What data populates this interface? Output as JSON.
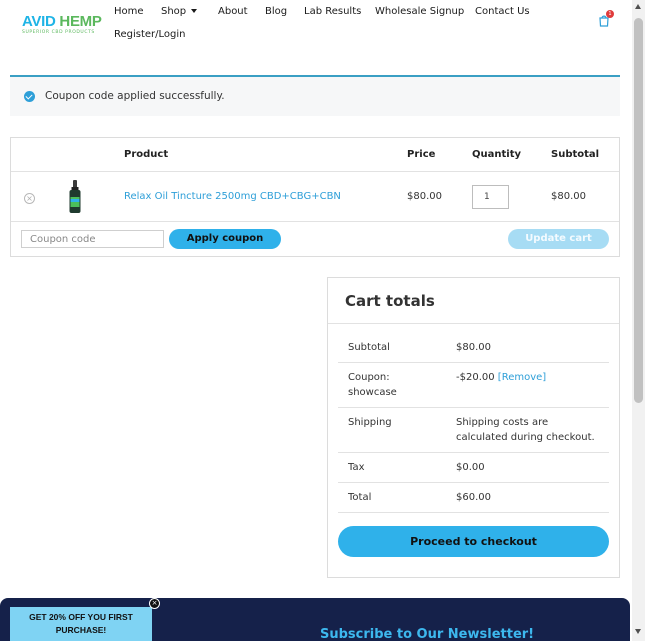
{
  "header": {
    "logo": {
      "main_a": "AVID",
      "main_b": "HEMP",
      "tagline": "SUPERIOR CBD PRODUCTS"
    },
    "nav": [
      {
        "label": "Home"
      },
      {
        "label": "Shop"
      },
      {
        "label": "About"
      },
      {
        "label": "Blog"
      },
      {
        "label": "Lab Results"
      },
      {
        "label": "Wholesale Signup"
      },
      {
        "label": "Contact Us"
      },
      {
        "label": "Register/Login"
      }
    ],
    "cart_count": "1"
  },
  "notice": {
    "text": "Coupon code applied successfully."
  },
  "cart_table": {
    "headers": {
      "product": "Product",
      "price": "Price",
      "quantity": "Quantity",
      "subtotal": "Subtotal"
    },
    "items": [
      {
        "name": "Relax Oil Tincture 2500mg CBD+CBG+CBN",
        "price": "$80.00",
        "quantity": "1",
        "subtotal": "$80.00"
      }
    ],
    "coupon_placeholder": "Coupon code",
    "apply_coupon_label": "Apply coupon",
    "update_cart_label": "Update cart"
  },
  "cart_totals": {
    "title": "Cart totals",
    "subtotal_label": "Subtotal",
    "subtotal_value": "$80.00",
    "coupon_label_1": "Coupon:",
    "coupon_label_2": "showcase",
    "coupon_value": "-$20.00",
    "coupon_remove": "[Remove]",
    "shipping_label": "Shipping",
    "shipping_value_1": "Shipping costs are",
    "shipping_value_2": "calculated during checkout.",
    "tax_label": "Tax",
    "tax_value": "$0.00",
    "total_label": "Total",
    "total_value": "$60.00",
    "checkout_label": "Proceed to checkout"
  },
  "promo": {
    "line1": "GET 20% OFF YOU FIRST",
    "line2": "PURCHASE!"
  },
  "newsletter": {
    "title": "Subscribe to Our Newsletter!"
  },
  "colors": {
    "accent": "#2fb1ea",
    "link": "#2e9fd8",
    "footer_bg": "#15214a",
    "badge": "#e03b3b"
  }
}
